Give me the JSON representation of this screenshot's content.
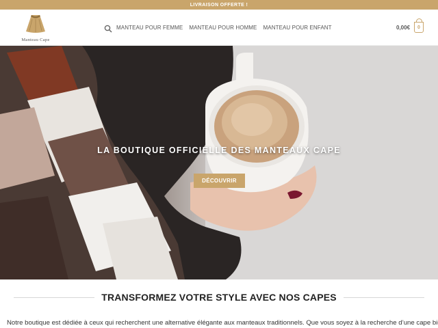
{
  "promo_bar": {
    "text": "LIVRAISON OFFERTE !"
  },
  "header": {
    "logo_text": "Manteau Cape",
    "search_icon": "search-icon",
    "nav": [
      {
        "label": "MANTEAU POUR FEMME"
      },
      {
        "label": "MANTEAU POUR HOMME"
      },
      {
        "label": "MANTEAU POUR ENFANT"
      }
    ],
    "cart_total": "0,00€",
    "cart_count": "0"
  },
  "hero": {
    "title": "LA BOUTIQUE OFFICIELLE DES MANTEAUX CAPE",
    "button_label": "DÉCOUVRIR"
  },
  "section": {
    "title": "TRANSFORMEZ VOTRE STYLE AVEC NOS CAPES",
    "intro": "Notre boutique est dédiée à ceux qui recherchent une alternative élégante aux manteaux traditionnels. Que vous soyez à la recherche d’une cape bien chaude"
  },
  "colors": {
    "accent": "#c9a56b",
    "text": "#222222",
    "nav_text": "#555555"
  }
}
